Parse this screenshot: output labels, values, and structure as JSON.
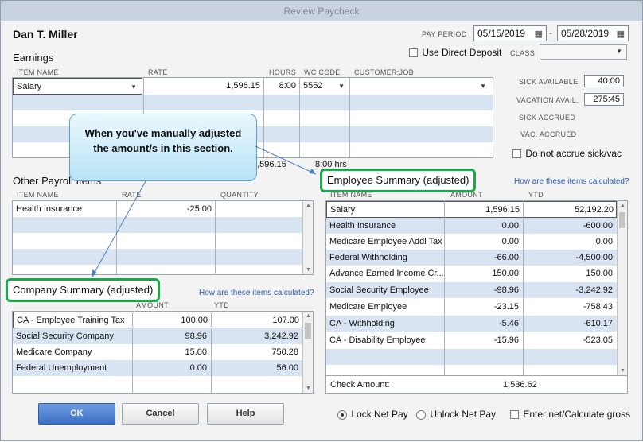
{
  "window": {
    "title": "Review Paycheck"
  },
  "employee": {
    "name": "Dan T. Miller"
  },
  "pay_period": {
    "label": "PAY PERIOD",
    "start": "05/15/2019",
    "separator": "-",
    "end": "05/28/2019"
  },
  "use_direct_deposit": {
    "label": "Use Direct Deposit",
    "checked": false
  },
  "class": {
    "label": "CLASS",
    "value": ""
  },
  "earnings": {
    "title": "Earnings",
    "headers": {
      "item": "ITEM NAME",
      "rate": "RATE",
      "hours": "HOURS",
      "wc": "WC CODE",
      "customer": "CUSTOMER:JOB"
    },
    "rows": [
      {
        "item": "Salary",
        "rate": "1,596.15",
        "hours": "8:00",
        "wc": "5552",
        "customer": ""
      }
    ],
    "total_amount": "1,596.15",
    "total_hours": "8:00 hrs"
  },
  "accruals": {
    "sick_available_label": "SICK AVAILABLE",
    "sick_available": "40:00",
    "vacation_avail_label": "VACATION AVAIL.",
    "vacation_avail": "275:45",
    "sick_accrued_label": "SICK ACCRUED",
    "vac_accrued_label": "VAC. ACCRUED",
    "do_not_accrue_label": "Do not accrue sick/vac"
  },
  "callout": {
    "text": "When you've manually adjusted the amount/s in this section."
  },
  "other_payroll": {
    "title": "Other Payroll Items",
    "headers": {
      "item": "ITEM NAME",
      "rate": "RATE",
      "quantity": "QUANTITY"
    },
    "rows": [
      {
        "item": "Health Insurance",
        "rate": "-25.00",
        "quantity": ""
      }
    ]
  },
  "employee_summary": {
    "title": "Employee Summary (adjusted)",
    "how_link": "How are these items calculated?",
    "headers": {
      "item": "ITEM NAME",
      "amount": "AMOUNT",
      "ytd": "YTD"
    },
    "rows": [
      {
        "item": "Salary",
        "amount": "1,596.15",
        "ytd": "52,192.20"
      },
      {
        "item": "Health Insurance",
        "amount": "0.00",
        "ytd": "-600.00"
      },
      {
        "item": "Medicare Employee Addl Tax",
        "amount": "0.00",
        "ytd": "0.00"
      },
      {
        "item": "Federal Withholding",
        "amount": "-66.00",
        "ytd": "-4,500.00"
      },
      {
        "item": "Advance Earned Income Cr...",
        "amount": "150.00",
        "ytd": "150.00"
      },
      {
        "item": "Social Security Employee",
        "amount": "-98.96",
        "ytd": "-3,242.92"
      },
      {
        "item": "Medicare Employee",
        "amount": "-23.15",
        "ytd": "-758.43"
      },
      {
        "item": "CA - Withholding",
        "amount": "-5.46",
        "ytd": "-610.17"
      },
      {
        "item": "CA - Disability Employee",
        "amount": "-15.96",
        "ytd": "-523.05"
      }
    ],
    "check_amount_label": "Check Amount:",
    "check_amount": "1,536.62"
  },
  "company_summary": {
    "title": "Company Summary  (adjusted)",
    "how_link": "How are these items calculated?",
    "headers": {
      "item": "ITEM NAME",
      "amount": "AMOUNT",
      "ytd": "YTD"
    },
    "rows": [
      {
        "item": "CA - Employee Training Tax",
        "amount": "100.00",
        "ytd": "107.00"
      },
      {
        "item": "Social Security Company",
        "amount": "98.96",
        "ytd": "3,242.92"
      },
      {
        "item": "Medicare Company",
        "amount": "15.00",
        "ytd": "750.28"
      },
      {
        "item": "Federal Unemployment",
        "amount": "0.00",
        "ytd": "56.00"
      }
    ]
  },
  "buttons": {
    "ok": "OK",
    "cancel": "Cancel",
    "help": "Help"
  },
  "options": {
    "lock_net_pay": "Lock Net Pay",
    "unlock_net_pay": "Unlock Net Pay",
    "enter_net": "Enter net/Calculate gross"
  },
  "colors": {
    "accent_green": "#19a94b",
    "link_blue": "#2a5db0",
    "row_alt": "#d9e4f2"
  }
}
